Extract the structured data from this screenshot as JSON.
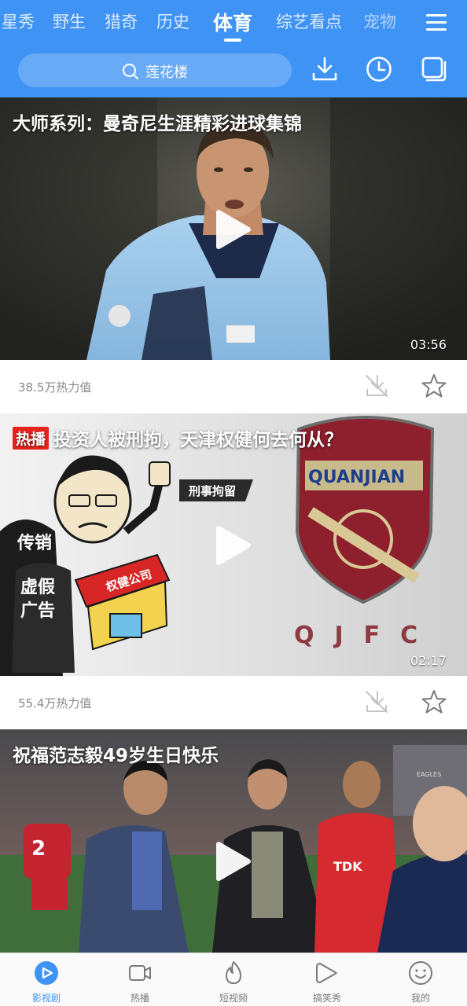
{
  "tabs": [
    "星秀",
    "野生",
    "猎奇",
    "历史",
    "体育",
    "综艺看点",
    "宠物"
  ],
  "active_tab": "体育",
  "search": {
    "placeholder": "莲花楼"
  },
  "feed": [
    {
      "title": "大师系列：曼奇尼生涯精彩进球集锦",
      "duration": "03:56",
      "heat": "38.5万热力值",
      "hot": false
    },
    {
      "badge": "热播",
      "title": "投资人被刑拘，天津权健何去何从？",
      "duration": "02:17",
      "heat": "55.4万热力值",
      "hot": true,
      "image_text": {
        "tag": "刑事拘留",
        "left1": "传销",
        "left2": "虚假",
        "left3": "广告",
        "sign": "权健公司",
        "crest": "QUANJIAN",
        "club": "QJFC"
      }
    },
    {
      "title": "祝福范志毅49岁生日快乐",
      "hot": false,
      "image_text": {
        "jersey": "TDK",
        "board": "EAGLES"
      }
    }
  ],
  "bottom_nav": [
    {
      "label": "影视剧",
      "icon": "play-circle-icon",
      "active": true
    },
    {
      "label": "热播",
      "icon": "video-camera-icon",
      "active": false
    },
    {
      "label": "短视频",
      "icon": "flame-icon",
      "active": false
    },
    {
      "label": "搞笑秀",
      "icon": "play-bubble-icon",
      "active": false
    },
    {
      "label": "我的",
      "icon": "smiley-icon",
      "active": false
    }
  ],
  "colors": {
    "brand": "#3f93f4",
    "hot_badge": "#e8231d",
    "header_text": "#ffffff"
  }
}
